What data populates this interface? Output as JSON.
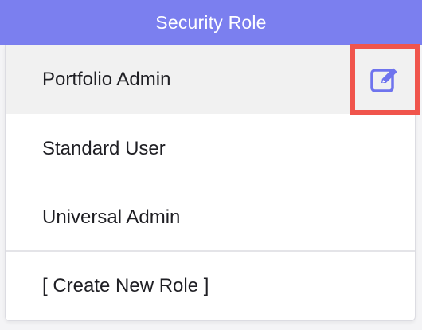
{
  "header": {
    "title": "Security Role"
  },
  "roles": [
    {
      "label": "Portfolio Admin",
      "selected": true
    },
    {
      "label": "Standard User",
      "selected": false
    },
    {
      "label": "Universal Admin",
      "selected": false
    }
  ],
  "actions": {
    "create_label": "[ Create New Role ]",
    "edit_icon": "edit-icon"
  },
  "colors": {
    "header_bg": "#7b7fef",
    "header_text": "#ffffff",
    "edit_icon": "#6f74ee",
    "highlight_border": "#f0554c",
    "selected_row_bg": "#f1f1f1"
  }
}
